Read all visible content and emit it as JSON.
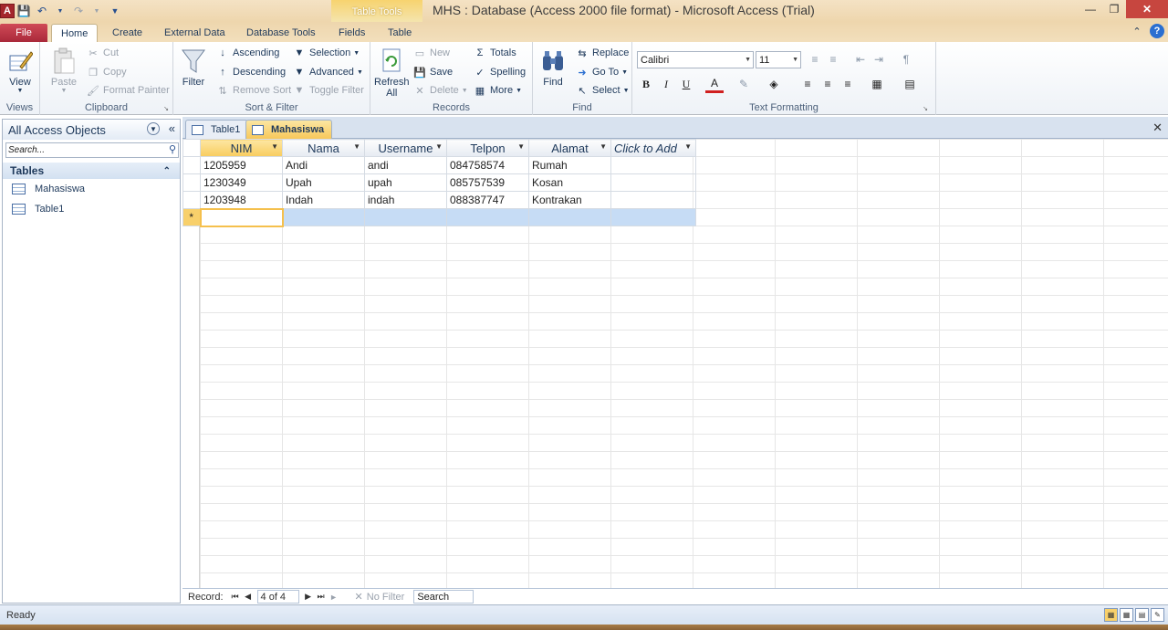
{
  "window": {
    "title": "MHS : Database (Access 2000 file format)  -  Microsoft Access (Trial)",
    "context_tab_group": "Table Tools",
    "app_icon_letter": "A"
  },
  "tabs": {
    "file": "File",
    "home": "Home",
    "create": "Create",
    "external": "External Data",
    "dbtools": "Database Tools",
    "fields": "Fields",
    "table": "Table"
  },
  "ribbon": {
    "views": {
      "view": "View",
      "label": "Views"
    },
    "clipboard": {
      "paste": "Paste",
      "cut": "Cut",
      "copy": "Copy",
      "format_painter": "Format Painter",
      "label": "Clipboard"
    },
    "sortfilter": {
      "filter": "Filter",
      "ascending": "Ascending",
      "descending": "Descending",
      "remove_sort": "Remove Sort",
      "selection": "Selection",
      "advanced": "Advanced",
      "toggle_filter": "Toggle Filter",
      "label": "Sort & Filter"
    },
    "records": {
      "refresh": "Refresh",
      "refresh2": "All",
      "new": "New",
      "save": "Save",
      "delete": "Delete",
      "totals": "Totals",
      "spelling": "Spelling",
      "more": "More",
      "label": "Records"
    },
    "find": {
      "find": "Find",
      "replace": "Replace",
      "goto": "Go To",
      "select": "Select",
      "label": "Find"
    },
    "text_formatting": {
      "font": "Calibri",
      "size": "11",
      "label": "Text Formatting",
      "bold": "B",
      "italic": "I",
      "underline": "U"
    }
  },
  "nav": {
    "header": "All Access Objects",
    "search_placeholder": "Search...",
    "group": "Tables",
    "items": [
      "Mahasiswa",
      "Table1"
    ]
  },
  "doc_tabs": [
    "Table1",
    "Mahasiswa"
  ],
  "table": {
    "columns": [
      "NIM",
      "Nama",
      "Username",
      "Telpon",
      "Alamat",
      "Click to Add"
    ],
    "rows": [
      [
        "1205959",
        "Andi",
        "andi",
        "084758574",
        "Rumah"
      ],
      [
        "1230349",
        "Upah",
        "upah",
        "085757539",
        "Kosan"
      ],
      [
        "1203948",
        "Indah",
        "indah",
        "088387747",
        "Kontrakan"
      ]
    ],
    "new_row_marker": "*"
  },
  "record_nav": {
    "label": "Record:",
    "position": "4 of 4",
    "no_filter": "No Filter",
    "search": "Search"
  },
  "status": {
    "text": "Ready"
  },
  "colors": {
    "context_tab": "#f7d36f",
    "file_tab": "#c23b4a",
    "active_doc_tab": "#f7c85a",
    "new_row": "#c6dcf5"
  }
}
